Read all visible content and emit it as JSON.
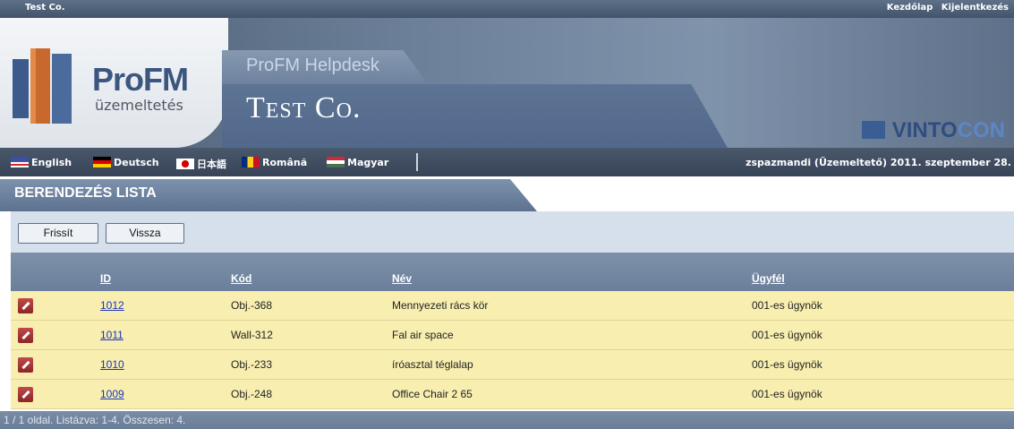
{
  "topbar": {
    "brand": "Test Co.",
    "links": [
      "Kezdőlap",
      "Kijelentkezés"
    ]
  },
  "header": {
    "logo_main": "ProFM",
    "logo_sub": "üzemeltetés",
    "app_title": "ProFM Helpdesk",
    "company": "Test Co.",
    "vendor_main": "VINTO",
    "vendor_accent": "CON"
  },
  "languages": [
    {
      "label": "English",
      "flag": "us-flag-icon"
    },
    {
      "label": "Deutsch",
      "flag": "de-flag-icon"
    },
    {
      "label": "日本語",
      "flag": "jp-flag-icon"
    },
    {
      "label": "Română",
      "flag": "ro-flag-icon"
    },
    {
      "label": "Magyar",
      "flag": "hu-flag-icon"
    }
  ],
  "userinfo": "zspazmandi (Üzemeltető) 2011. szeptember 28.",
  "page_title": "BERENDEZÉS LISTA",
  "buttons": {
    "refresh": "Frissít",
    "back": "Vissza"
  },
  "table": {
    "headers": {
      "id": "ID",
      "code": "Kód",
      "name": "Név",
      "client": "Ügyfél"
    },
    "rows": [
      {
        "id": "1012",
        "code": "Obj.-368",
        "name": "Mennyezeti rács kör",
        "client": "001-es ügynök"
      },
      {
        "id": "1011",
        "code": "Wall-312",
        "name": "Fal air space",
        "client": "001-es ügynök"
      },
      {
        "id": "1010",
        "code": "Obj.-233",
        "name": "íróasztal téglalap",
        "client": "001-es ügynök"
      },
      {
        "id": "1009",
        "code": "Obj.-248",
        "name": "Office Chair 2 65",
        "client": "001-es ügynök"
      }
    ]
  },
  "footer": "1 / 1 oldal. Listázva: 1-4. Összesen: 4.",
  "colors": {
    "row_bg": "#f7eeb0",
    "header_bg": "#7e91aa",
    "link": "#1a35b8",
    "accent_gold": "#e6c984"
  }
}
